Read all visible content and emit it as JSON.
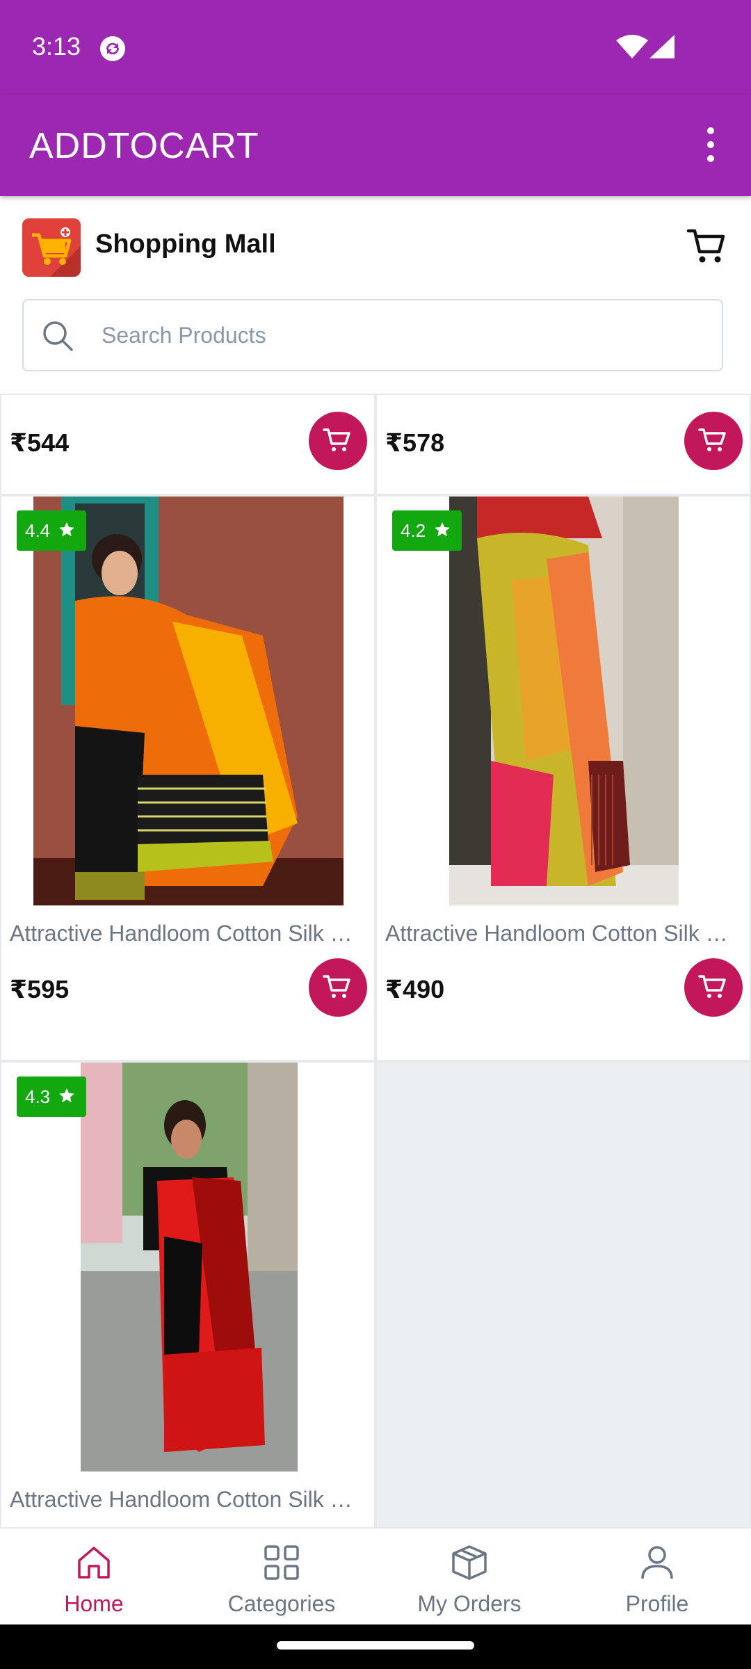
{
  "status_bar": {
    "time": "3:13"
  },
  "app_bar": {
    "title": "ADDTOCART"
  },
  "store": {
    "name": "Shopping Mall"
  },
  "search": {
    "placeholder": "Search Products"
  },
  "products_partial_top": [
    {
      "price": "₹544"
    },
    {
      "price": "₹578"
    }
  ],
  "products": [
    {
      "rating": "4.4",
      "title": "Attractive Handloom Cotton Silk Saree",
      "price": "₹595"
    },
    {
      "rating": "4.2",
      "title": "Attractive Handloom Cotton Silk Saree",
      "price": "₹490"
    },
    {
      "rating": "4.3",
      "title": "Attractive Handloom Cotton Silk Saree"
    }
  ],
  "bottom_nav": [
    {
      "label": "Home",
      "icon": "home-icon",
      "active": true
    },
    {
      "label": "Categories",
      "icon": "grid-icon"
    },
    {
      "label": "My Orders",
      "icon": "box-icon"
    },
    {
      "label": "Profile",
      "icon": "person-icon"
    }
  ],
  "colors": {
    "primary": "#9c27b0",
    "accent": "#c2185b",
    "rating_badge": "#13a80f"
  }
}
